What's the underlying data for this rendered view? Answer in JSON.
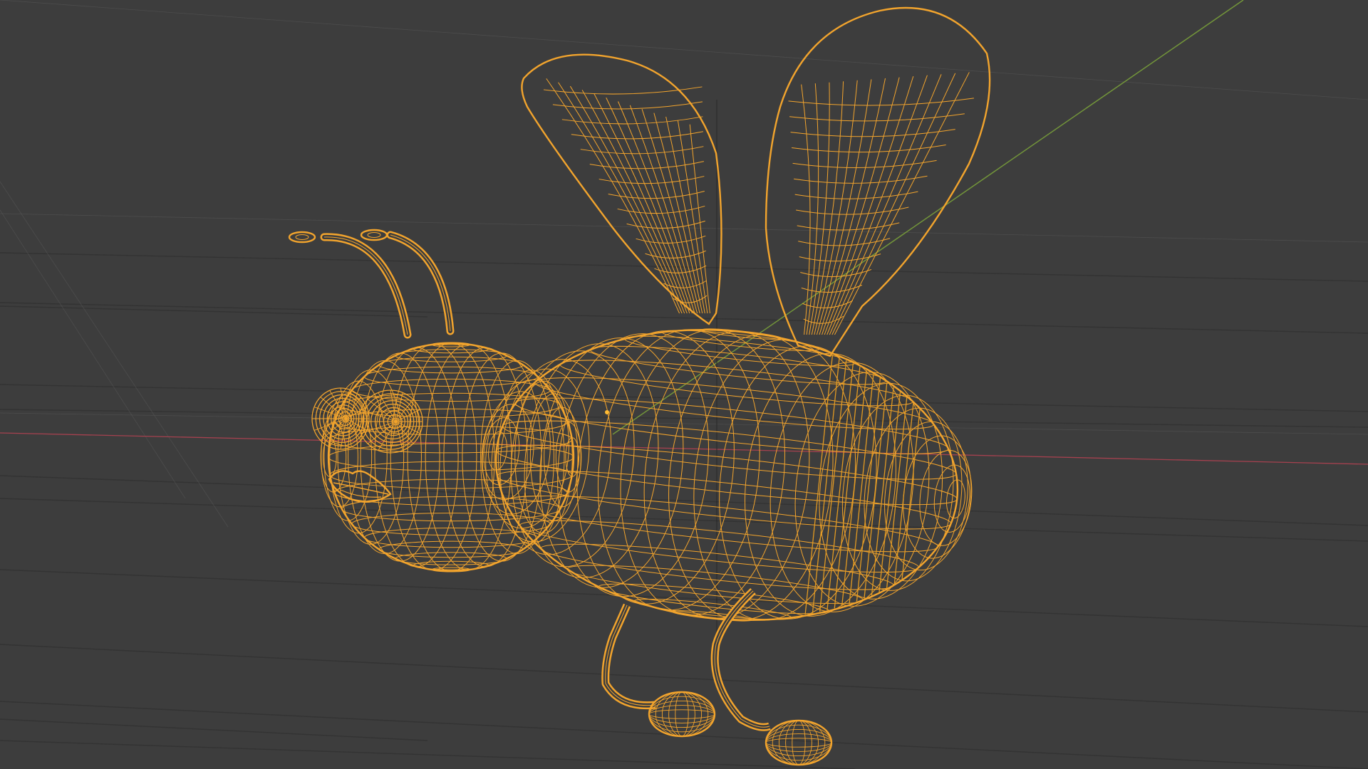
{
  "viewport": {
    "shading_mode": "wireframe",
    "background_color": "#3d3d3d",
    "grid_color": "#333333",
    "grid_light_color": "#595959",
    "x_axis_color": "#a5414f",
    "y_axis_color": "#73963a",
    "wire_color": "#f2a42d",
    "wire_dark_color": "#e29a22",
    "origin_color": "#ffbb33",
    "selected_object": "bee",
    "selected_object_icon": "bee-wireframe-mesh"
  }
}
